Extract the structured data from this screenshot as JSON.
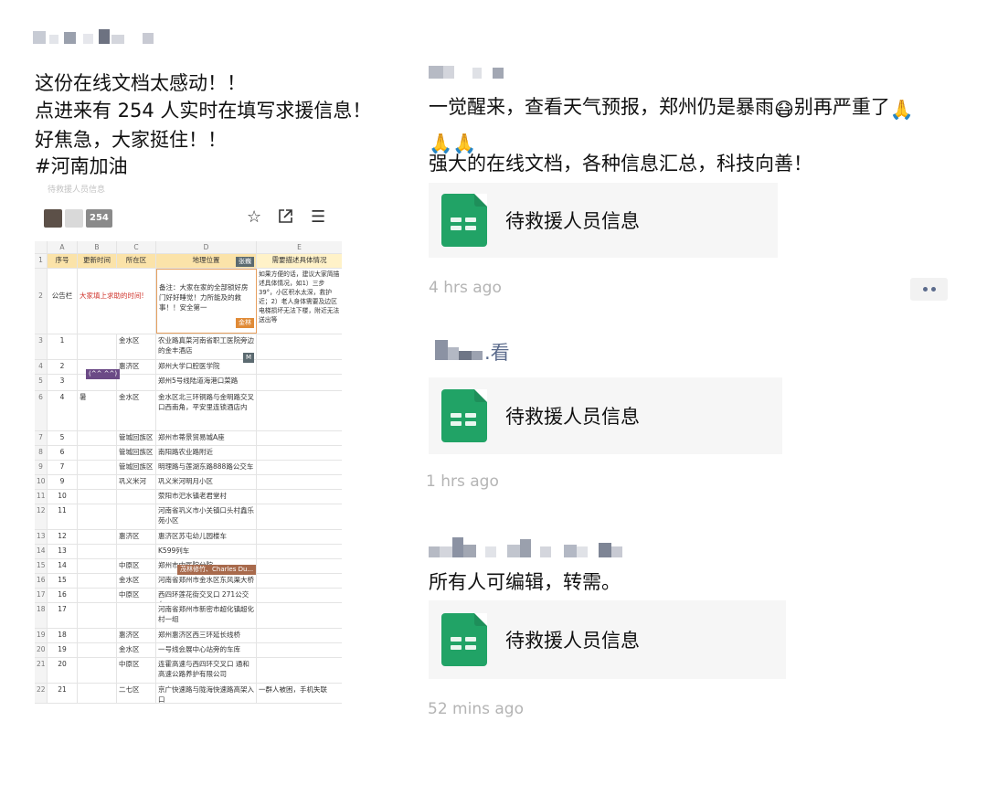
{
  "post_left": {
    "lines": [
      "这份在线文档太感动！！",
      "点进来有 254 人实时在填写求援信息！",
      "好焦急，大家挺住！！",
      "#河南加油"
    ]
  },
  "spreadsheet": {
    "cut_title": "待救援人员信息",
    "editor_count": "254",
    "col_letters": [
      "A",
      "B",
      "C",
      "D",
      "E"
    ],
    "headers": [
      "序号",
      "更新时间",
      "所在区",
      "地理位置",
      "需要描述具体情况"
    ],
    "row2": {
      "a": "公告栏",
      "b": "大家填上求助的时间!",
      "d": "备注：大家在家的全部锁好房门好好睡觉！力所能及的救事！！安全第一",
      "e": "如果方便的话，建议大家简描述具体情况，如1）三步39°，小区积水太深，救护近；2）老人身体需要及边区电梯损坏无法下楼，附近无法送出等"
    },
    "rows": [
      {
        "n": "3",
        "a": "1",
        "c": "金水区",
        "d": "农业路真菜河南省职工医院旁边的金丰酒店",
        "e": ""
      },
      {
        "n": "4",
        "a": "2",
        "c": "惠济区",
        "d": "郑州大学口腔医学院",
        "e": ""
      },
      {
        "n": "5",
        "a": "3",
        "c": "",
        "d": "郑州5号线陆道海港口菜路",
        "e": ""
      },
      {
        "n": "6",
        "a": "4",
        "b": "暑",
        "c": "金水区",
        "d": "金水区北三环铜路与金明路交叉口西南角，平安里连锁酒店内",
        "e": ""
      },
      {
        "n": "7",
        "a": "5",
        "c": "管城回族区",
        "d": "郑州市蒂景贸易城A座",
        "e": ""
      },
      {
        "n": "8",
        "a": "6",
        "c": "管城回族区",
        "d": "南阳路农业路附近",
        "e": ""
      },
      {
        "n": "9",
        "a": "7",
        "c": "管城回族区",
        "d": "明理路与莲湖东路888路公交车",
        "e": ""
      },
      {
        "n": "10",
        "a": "9",
        "c": "巩义米河",
        "d": "巩义米河明月小区",
        "e": ""
      },
      {
        "n": "11",
        "a": "10",
        "c": "",
        "d": "荥阳市汜水镇老君堂村",
        "e": ""
      },
      {
        "n": "12",
        "a": "11",
        "c": "",
        "d": "河南省巩义市小关镇口头村鑫乐苑小区",
        "e": ""
      },
      {
        "n": "13",
        "a": "12",
        "c": "惠济区",
        "d": "惠济区苏屯幼儿园楼车",
        "e": ""
      },
      {
        "n": "14",
        "a": "13",
        "c": "",
        "d": "K599列车",
        "e": ""
      },
      {
        "n": "15",
        "a": "14",
        "c": "中原区",
        "d": "郑州市中医院分院",
        "e": ""
      },
      {
        "n": "16",
        "a": "15",
        "c": "金水区",
        "d": "河南省郑州市金水区东风渠大桥",
        "e": ""
      },
      {
        "n": "17",
        "a": "16",
        "c": "中原区",
        "d": "西四环莲花街交叉口 271公交车",
        "e": ""
      },
      {
        "n": "18",
        "a": "17",
        "c": "",
        "d": "河南省郑州市新密市超化镇超化村一组",
        "e": ""
      },
      {
        "n": "19",
        "a": "18",
        "c": "惠济区",
        "d": "郑州惠济区西三环延长线桥",
        "e": ""
      },
      {
        "n": "20",
        "a": "19",
        "c": "金水区",
        "d": "一号线会展中心站旁的车库",
        "e": ""
      },
      {
        "n": "21",
        "a": "20",
        "c": "中原区",
        "d": "连霍高速与西四环交叉口 通和高速公路养护有限公司",
        "e": ""
      },
      {
        "n": "22",
        "a": "21",
        "c": "二七区",
        "d": "京广快速路与陇海快速路高架入口",
        "e": "一群人被困，手机失联"
      }
    ],
    "tags": {
      "zhangwei": "张巍",
      "jinlin": "金林",
      "m": "M",
      "kaomoji": "(^^ ^^)",
      "collab": "茂林修竹、Charles Du..."
    }
  },
  "posts_right": [
    {
      "text_line1": "一觉醒来，查看天气预报，郑州仍是暴雨",
      "text_line1b": "别再严重了",
      "emoji_worried": "😷",
      "emoji_pray": "🙏",
      "text_line2": "强大的在线文档，各种信息汇总，科技向善！",
      "card_title": "待救援人员信息",
      "time": "4 hrs ago"
    },
    {
      "name_suffix": ".看",
      "card_title": "待救援人员信息",
      "time": "1 hrs ago"
    },
    {
      "text": "所有人可编辑，转需。",
      "card_title": "待救援人员信息",
      "time": "52 mins ago"
    }
  ],
  "colors": {
    "sheet_green": "#21a366",
    "card_bg": "#f6f6f6",
    "timestamp": "#b4b4b4",
    "more_dots": "#5b6b8c"
  }
}
